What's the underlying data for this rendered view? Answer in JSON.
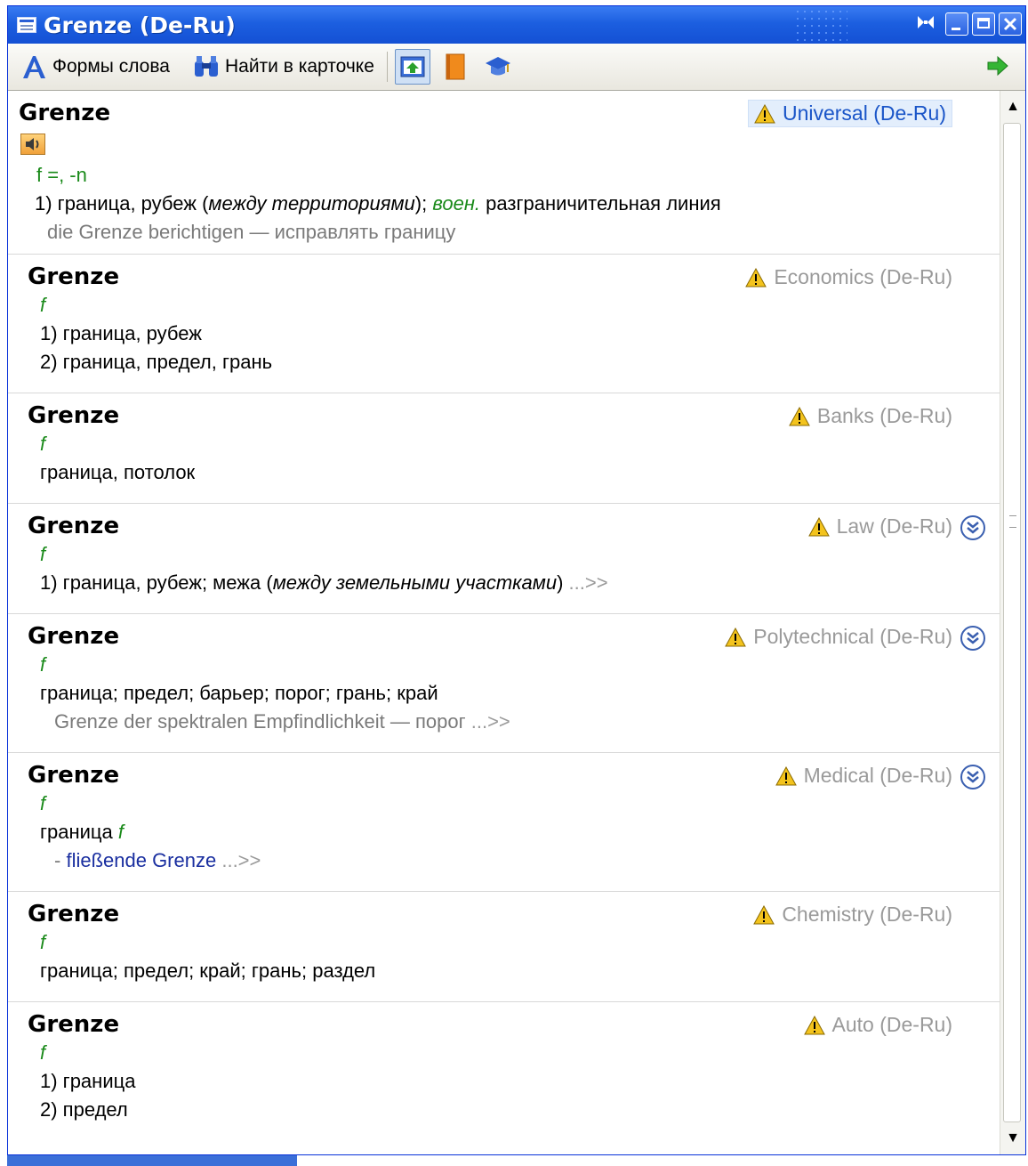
{
  "window": {
    "title": "Grenze (De-Ru)"
  },
  "toolbar": {
    "word_forms": "Формы слова",
    "find_in_card": "Найти в карточке"
  },
  "colors": {
    "titlebar": "#1c5fe0",
    "grammar_green": "#1a8a1a",
    "link_blue": "#1a2fa0",
    "example_gray": "#7a7a7a"
  },
  "cards": [
    {
      "headword": "Grenze",
      "dictionary": "Universal (De-Ru)",
      "grammar": "f =, -n",
      "sense_1": "1) граница, рубеж (",
      "sense_1_ital": "между территориями",
      "sense_1_end": ");",
      "label": "воен.",
      "sense_1_tail": "разграничительная линия",
      "example": "die Grenze berichtigen — исправлять границу"
    },
    {
      "headword": "Grenze",
      "dictionary": "Economics (De-Ru)",
      "grammar": "f",
      "sense_1": "1) граница, рубеж",
      "sense_2": "2) граница, предел, грань"
    },
    {
      "headword": "Grenze",
      "dictionary": "Banks (De-Ru)",
      "grammar": "f",
      "sense_1": "граница, потолок"
    },
    {
      "headword": "Grenze",
      "dictionary": "Law (De-Ru)",
      "grammar": "f",
      "sense_1": "1) граница, рубеж; межа (",
      "sense_1_ital": "между земельными участками",
      "sense_1_end": ")",
      "more": "...>>"
    },
    {
      "headword": "Grenze",
      "dictionary": "Polytechnical (De-Ru)",
      "grammar": "f",
      "sense_1": "граница; предел; барьер; порог; грань; край",
      "example": "Grenze der spektralen Empfindlichkeit — порог",
      "more": "...>>"
    },
    {
      "headword": "Grenze",
      "dictionary": "Medical (De-Ru)",
      "grammar": "f",
      "sense_1": "граница",
      "sense_1_gram": "f",
      "sub_prefix": "- ",
      "sub_link": "fließende Grenze",
      "more": "...>>"
    },
    {
      "headword": "Grenze",
      "dictionary": "Chemistry (De-Ru)",
      "grammar": "f",
      "sense_1": "граница; предел; край; грань; раздел"
    },
    {
      "headword": "Grenze",
      "dictionary": "Auto (De-Ru)",
      "grammar": "f",
      "sense_1": "1) граница",
      "sense_2": "2) предел"
    }
  ]
}
